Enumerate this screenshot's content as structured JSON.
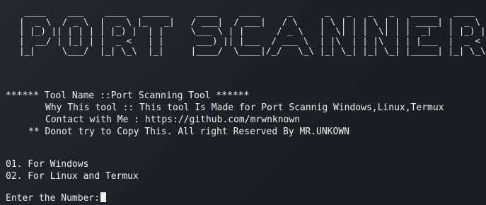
{
  "banner": {
    "ascii_art": " ____    ___    ____   _____     ____    ____     _      _   _   _   _   _____   ____  \n|  _ \\  / _ \\  |  _ \\ |_   _|   / ___|  / ___|   / \\    | \\ | | | \\ | | | ____| |  _ \\ \n| |_) || | | | | |_) |  | |     \\___ \\ | |      / _ \\   |  \\| | |  \\| | |  _|   | |_) |\n|  __/ | |_| | |  _ <   | |      ___) || |___  / ___ \\  | |\\  | | |\\  | | |___  |  _ < \n|_|     \\___/  |_| \\_\\  |_|     |____/  \\____|/_/   \\_\\ |_| \\_| |_| \\_| |_____| |_| \\_\\"
  },
  "info": {
    "tool_name": "****** Tool Name ::Port Scanning Tool ******",
    "why_tool": "Why This tool :: This tool Is Made for Port Scannig Windows,Linux,Termux",
    "contact": "Contact with Me : https://github.com/mrwnknown",
    "notice": "** Donot try to Copy This. All right Reserved By MR.UNKOWN"
  },
  "menu": {
    "option1": "01. For Windows",
    "option2": "02. For Linux and Termux"
  },
  "prompt": {
    "label": "Enter the Number:"
  },
  "colors": {
    "background": "#1e2128",
    "text": "#f0f0f0"
  }
}
